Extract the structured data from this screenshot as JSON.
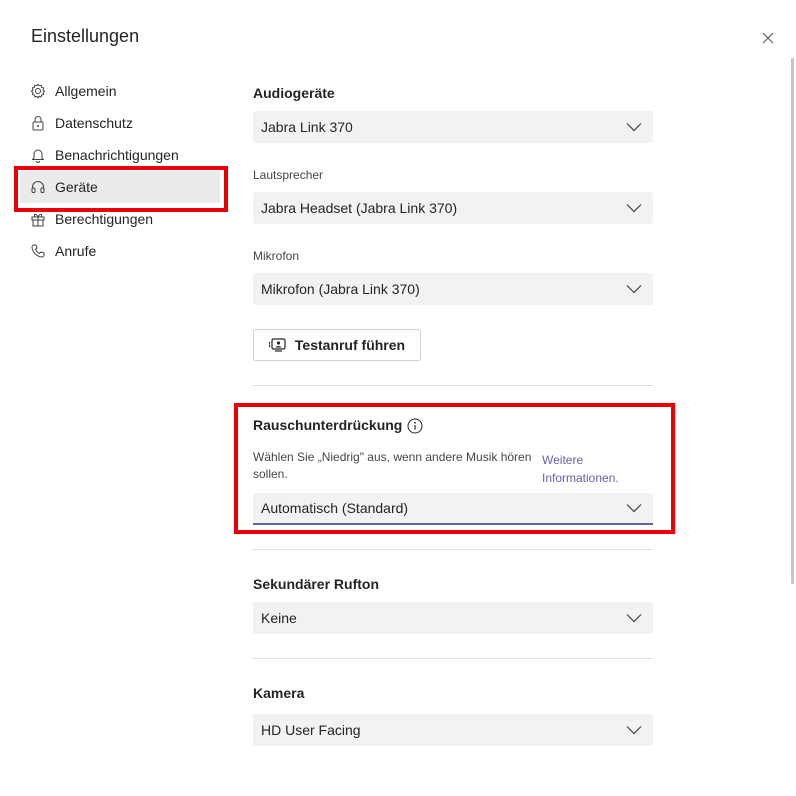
{
  "window": {
    "title": "Einstellungen"
  },
  "sidebar": {
    "items": [
      {
        "label": "Allgemein",
        "icon": "gear-icon"
      },
      {
        "label": "Datenschutz",
        "icon": "lock-icon"
      },
      {
        "label": "Benachrichtigungen",
        "icon": "bell-icon"
      },
      {
        "label": "Geräte",
        "icon": "headset-icon",
        "active": true
      },
      {
        "label": "Berechtigungen",
        "icon": "gift-box-icon"
      },
      {
        "label": "Anrufe",
        "icon": "phone-icon"
      }
    ]
  },
  "audio": {
    "title": "Audiogeräte",
    "device_value": "Jabra Link 370",
    "speaker_label": "Lautsprecher",
    "speaker_value": "Jabra Headset (Jabra Link 370)",
    "mic_label": "Mikrofon",
    "mic_value": "Mikrofon (Jabra Link 370)",
    "test_call_label": "Testanruf führen"
  },
  "noise": {
    "title": "Rauschunterdrückung",
    "description": "Wählen Sie „Niedrig\" aus, wenn andere Musik hören sollen.",
    "link": "Weitere Informationen.",
    "value": "Automatisch (Standard)"
  },
  "ringer": {
    "title": "Sekundärer Rufton",
    "value": "Keine"
  },
  "camera": {
    "title": "Kamera",
    "value": "HD User Facing"
  },
  "colors": {
    "highlight": "#e8000b",
    "accent": "#6264a7",
    "dropdown_bg": "#f3f2f1"
  }
}
